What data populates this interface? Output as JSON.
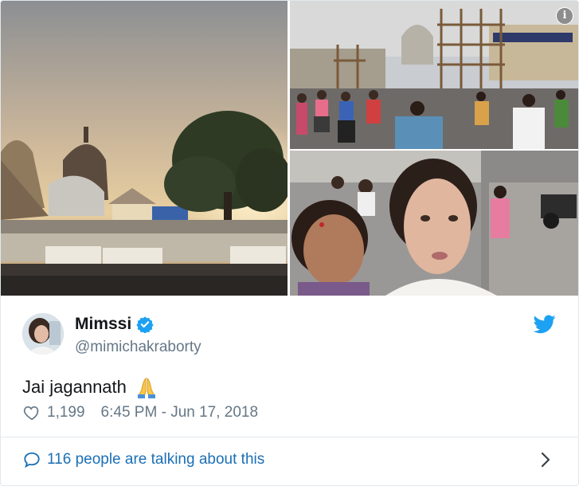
{
  "tweet": {
    "author": {
      "display_name": "Mimssi",
      "handle": "@mimichakraborty",
      "verified": true,
      "avatar_icon": "avatar-photo"
    },
    "text": "Jai jagannath",
    "emoji_icon": "folded-hands-icon",
    "likes": "1,199",
    "timestamp": "6:45 PM - Jun 17, 2018",
    "conversation_label": "116 people are talking about this"
  },
  "media": {
    "photos": [
      {
        "icon": "temple-sunset-photo"
      },
      {
        "icon": "street-crowd-photo"
      },
      {
        "icon": "selfie-photo"
      }
    ],
    "info_glyph": "i"
  },
  "colors": {
    "twitter_blue": "#1da1f2",
    "link_blue": "#1b6fb5",
    "muted_gray": "#657786",
    "text_dark": "#14171a",
    "border": "#e1e8ed"
  }
}
